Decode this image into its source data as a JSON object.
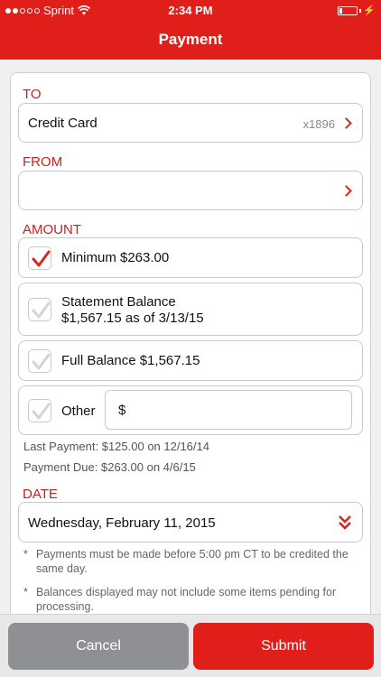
{
  "status_bar": {
    "carrier": "Sprint",
    "time": "2:34 PM"
  },
  "header": {
    "title": "Payment"
  },
  "to": {
    "label": "TO",
    "account": "Credit Card",
    "account_suffix": "x1896"
  },
  "from": {
    "label": "FROM",
    "account": ""
  },
  "amount": {
    "label": "AMOUNT",
    "options": [
      {
        "line1": "Minimum $263.00",
        "line2": "",
        "checked": true
      },
      {
        "line1": "Statement Balance",
        "line2": "$1,567.15 as of 3/13/15",
        "checked": false
      },
      {
        "line1": "Full Balance $1,567.15",
        "line2": "",
        "checked": false
      },
      {
        "line1": "Other",
        "line2": "",
        "checked": false
      }
    ],
    "other_value": "$"
  },
  "payment_info": {
    "last_payment": "Last Payment: $125.00 on 12/16/14",
    "payment_due": "Payment Due: $263.00 on 4/6/15"
  },
  "date": {
    "label": "DATE",
    "value": "Wednesday, February 11, 2015"
  },
  "notes": [
    {
      "bullet": "*",
      "text": "Payments must be made before 5:00 pm CT to be credited the same day."
    },
    {
      "bullet": "*",
      "text": "Balances displayed may not include some items pending for processing."
    }
  ],
  "actions": {
    "cancel": "Cancel",
    "submit": "Submit"
  },
  "colors": {
    "brand_red": "#e01f1b",
    "cancel_gray": "#8e9093"
  }
}
